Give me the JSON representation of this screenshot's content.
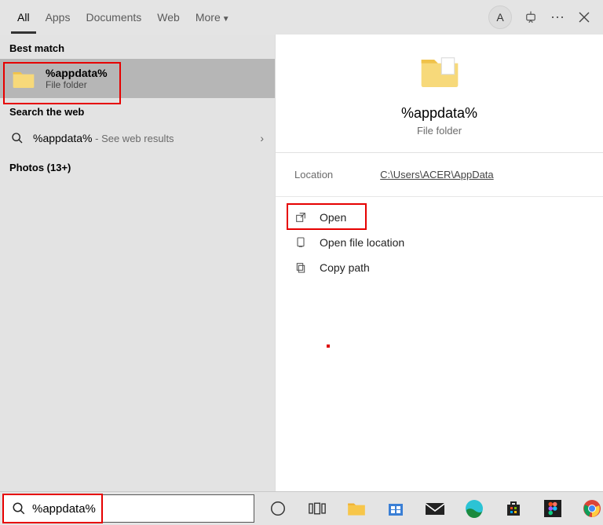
{
  "header": {
    "tabs": [
      "All",
      "Apps",
      "Documents",
      "Web",
      "More"
    ],
    "avatar": "A"
  },
  "left": {
    "best_match": "Best match",
    "result": {
      "title": "%appdata%",
      "subtitle": "File folder"
    },
    "search_web": "Search the web",
    "web": {
      "query": "%appdata%",
      "sub": " - See web results"
    },
    "photos": "Photos (13+)"
  },
  "preview": {
    "title": "%appdata%",
    "subtitle": "File folder",
    "location_label": "Location",
    "location_value": "C:\\Users\\ACER\\AppData",
    "actions": {
      "open": "Open",
      "open_loc": "Open file location",
      "copy": "Copy path"
    }
  },
  "search": {
    "value": "%appdata%"
  }
}
